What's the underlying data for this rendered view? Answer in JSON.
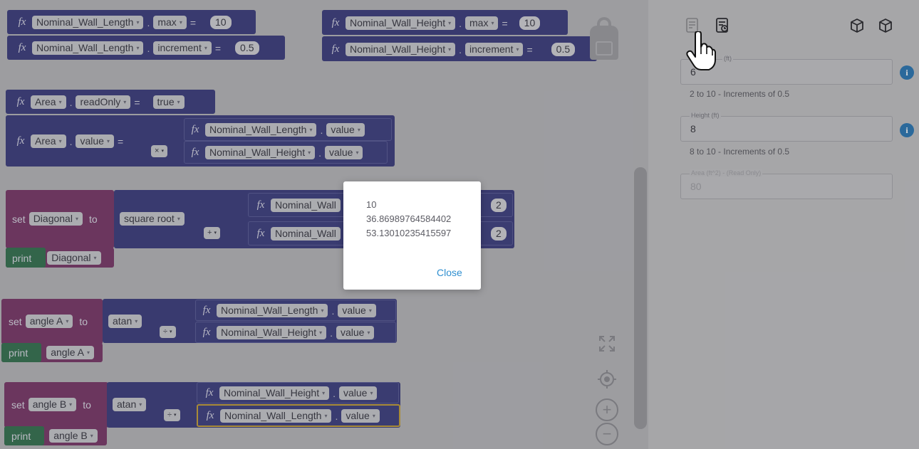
{
  "workspace": {
    "blocks": {
      "len_max": {
        "prop": "Nominal_Wall_Length",
        "attr": "max",
        "eq": "=",
        "value": "10"
      },
      "len_inc": {
        "prop": "Nominal_Wall_Length",
        "attr": "increment",
        "eq": "=",
        "value": "0.5"
      },
      "hgt_max": {
        "prop": "Nominal_Wall_Height",
        "attr": "max",
        "eq": "=",
        "value": "10"
      },
      "hgt_inc": {
        "prop": "Nominal_Wall_Height",
        "attr": "increment",
        "eq": "=",
        "value": "0.5"
      },
      "area_ro": {
        "prop": "Area",
        "attr": "readOnly",
        "eq": "=",
        "value": "true"
      },
      "area_val": {
        "prop": "Area",
        "attr": "value",
        "eq": "=",
        "op": "×",
        "a_prop": "Nominal_Wall_Length",
        "a_attr": "value",
        "b_prop": "Nominal_Wall_Height",
        "b_attr": "value"
      },
      "diagonal": {
        "set": "set",
        "var": "Diagonal",
        "to": "to",
        "func": "square root",
        "op": "+",
        "a_prop": "Nominal_Wall",
        "b_prop": "Nominal_Wall",
        "exp_a": "2",
        "exp_b": "2"
      },
      "print_diag": {
        "print": "print",
        "var": "Diagonal"
      },
      "angle_a": {
        "set": "set",
        "var": "angle A",
        "to": "to",
        "func": "atan",
        "op": "÷",
        "a_prop": "Nominal_Wall_Length",
        "a_attr": "value",
        "b_prop": "Nominal_Wall_Height",
        "b_attr": "value"
      },
      "print_a": {
        "print": "print",
        "var": "angle A"
      },
      "angle_b": {
        "set": "set",
        "var": "angle B",
        "to": "to",
        "func": "atan",
        "op": "÷",
        "a_prop": "Nominal_Wall_Height",
        "a_attr": "value",
        "b_prop": "Nominal_Wall_Length",
        "b_attr": "value"
      },
      "print_b": {
        "print": "print",
        "var": "angle B"
      }
    },
    "fx": "fx",
    "dot": "."
  },
  "dialog": {
    "lines": [
      "10",
      "36.86989764584402",
      "53.13010235415597"
    ],
    "close_label": "Close"
  },
  "panel": {
    "length": {
      "label": "(ft)",
      "value": "6",
      "hint": "2 to 10 - Increments of 0.5"
    },
    "height": {
      "label": "Height (ft)",
      "value": "8",
      "hint": "8 to 10 - Increments of 0.5"
    },
    "area": {
      "label": "Area (ft^2) - (Read Only)",
      "value": "80"
    },
    "info_glyph": "i"
  },
  "colors": {
    "property_block": "#3d3f7e",
    "variable_block": "#7a3a6a",
    "print_block": "#367351",
    "link": "#2f8fd0",
    "info": "#2c78b4"
  }
}
